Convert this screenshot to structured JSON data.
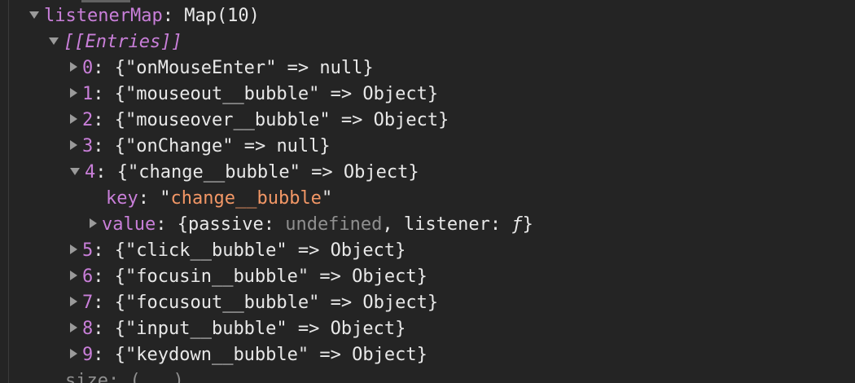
{
  "listener_map": {
    "name": "listenerMap",
    "type": "Map(10)",
    "entries_label": "[[Entries]]",
    "entries": [
      {
        "index": "0",
        "key": "onMouseEnter",
        "value": "null",
        "expanded": false
      },
      {
        "index": "1",
        "key": "mouseout__bubble",
        "value": "Object",
        "expanded": false
      },
      {
        "index": "2",
        "key": "mouseover__bubble",
        "value": "Object",
        "expanded": false
      },
      {
        "index": "3",
        "key": "onChange",
        "value": "null",
        "expanded": false
      },
      {
        "index": "4",
        "key": "change__bubble",
        "value": "Object",
        "expanded": true
      },
      {
        "index": "5",
        "key": "click__bubble",
        "value": "Object",
        "expanded": false
      },
      {
        "index": "6",
        "key": "focusin__bubble",
        "value": "Object",
        "expanded": false
      },
      {
        "index": "7",
        "key": "focusout__bubble",
        "value": "Object",
        "expanded": false
      },
      {
        "index": "8",
        "key": "input__bubble",
        "value": "Object",
        "expanded": false
      },
      {
        "index": "9",
        "key": "keydown__bubble",
        "value": "Object",
        "expanded": false
      }
    ],
    "expanded_entry": {
      "key_label": "key",
      "key_value": "change__bubble",
      "value_label": "value",
      "passive_label": "passive",
      "passive_value": "undefined",
      "listener_label": "listener",
      "listener_value": "ƒ"
    },
    "size_label": "size",
    "size_value": "(...)"
  },
  "colors": {
    "background": "#242424",
    "property": "#c97fd9",
    "string": "#f29766",
    "text": "#e8e8e8",
    "dim": "#8f8f8f",
    "triangle": "#9a9a9a"
  }
}
